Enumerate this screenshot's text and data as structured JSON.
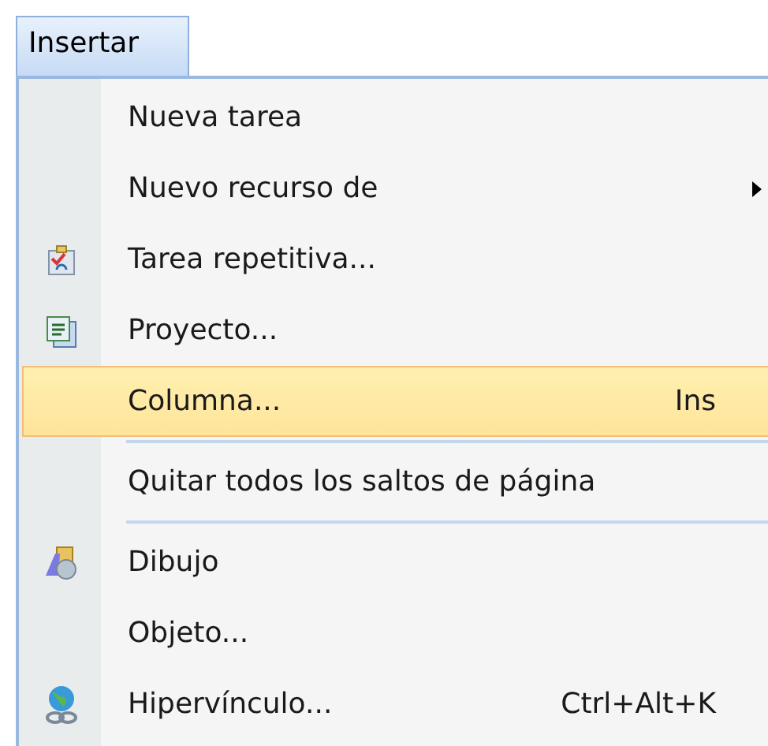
{
  "menu_title": "Insertar",
  "items": [
    {
      "kind": "item",
      "label": "Nueva tarea",
      "selected": false
    },
    {
      "kind": "item",
      "label": "Nuevo recurso de",
      "submenu": true,
      "selected": false
    },
    {
      "kind": "item",
      "label": "Tarea repetitiva...",
      "selected": false
    },
    {
      "kind": "item",
      "label": "Proyecto...",
      "selected": false
    },
    {
      "kind": "item",
      "label": "Columna...",
      "shortcut": "Ins",
      "selected": true
    },
    {
      "kind": "separator"
    },
    {
      "kind": "item",
      "label": "Quitar todos los saltos de página",
      "selected": false
    },
    {
      "kind": "separator"
    },
    {
      "kind": "item",
      "label": "Dibujo",
      "selected": false
    },
    {
      "kind": "item",
      "label": "Objeto...",
      "selected": false
    },
    {
      "kind": "item",
      "label": "Hipervínculo...",
      "shortcut": "Ctrl+Alt+K",
      "selected": false
    }
  ]
}
